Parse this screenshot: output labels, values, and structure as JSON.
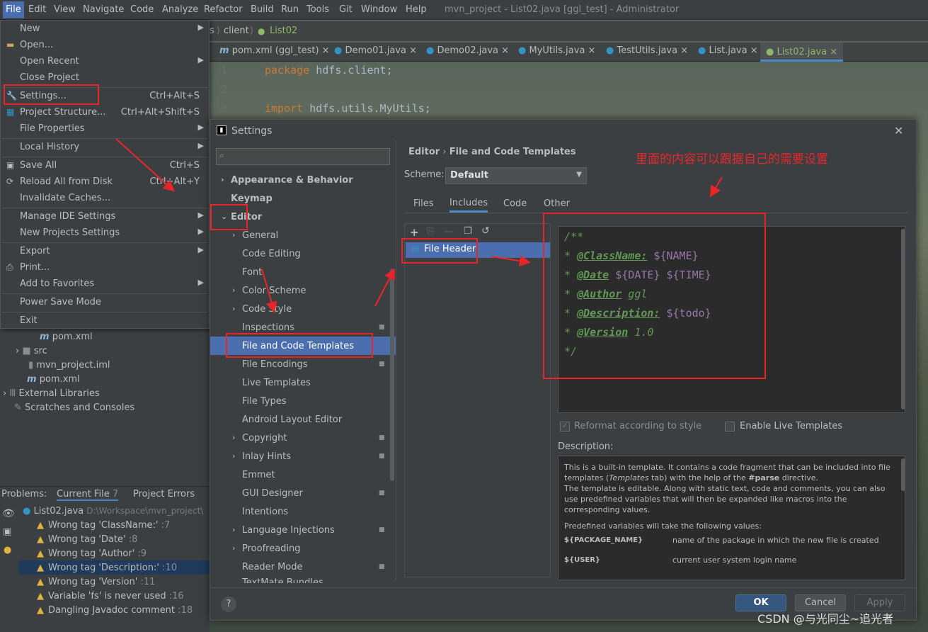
{
  "menubar": {
    "items": [
      "File",
      "Edit",
      "View",
      "Navigate",
      "Code",
      "Analyze",
      "Refactor",
      "Build",
      "Run",
      "Tools",
      "Git",
      "Window",
      "Help"
    ],
    "window_title": "mvn_project - List02.java [ggl_test] - Administrator"
  },
  "breadcrumb": {
    "part1": "s",
    "part2": "client",
    "part3": "List02"
  },
  "editor_tabs": [
    "pom.xml (ggl_test)",
    "Demo01.java",
    "Demo02.java",
    "MyUtils.java",
    "TestUtils.java",
    "List.java",
    "List02.java"
  ],
  "code": {
    "line1_no": "1",
    "line1_kw": "package",
    "line1_rest": " hdfs.client;",
    "line2_no": "2",
    "line3_no": "3",
    "line3_kw": "import",
    "line3_rest": " hdfs.utils.MyUtils;"
  },
  "file_menu": {
    "new": "New",
    "open": "Open...",
    "open_recent": "Open Recent",
    "close_project": "Close Project",
    "settings": "Settings...",
    "settings_sc": "Ctrl+Alt+S",
    "project_structure": "Project Structure...",
    "project_structure_sc": "Ctrl+Alt+Shift+S",
    "file_properties": "File Properties",
    "local_history": "Local History",
    "save_all": "Save All",
    "save_all_sc": "Ctrl+S",
    "reload": "Reload All from Disk",
    "reload_sc": "Ctrl+Alt+Y",
    "invalidate": "Invalidate Caches...",
    "manage_ide": "Manage IDE Settings",
    "new_projects": "New Projects Settings",
    "export": "Export",
    "print": "Print...",
    "favorites": "Add to Favorites",
    "power_save": "Power Save Mode",
    "exit": "Exit"
  },
  "project_tree": {
    "pom1": "pom.xml",
    "src": "src",
    "iml": "mvn_project.iml",
    "pom2": "pom.xml",
    "ext_libs": "External Libraries",
    "scratches": "Scratches and Consoles"
  },
  "problems": {
    "tab_label": "Problems:",
    "current_file": "Current File",
    "current_file_count": "7",
    "project_errors": "Project Errors",
    "file": "List02.java",
    "path": "D:\\Workspace\\mvn_project\\",
    "items": [
      {
        "text": "Wrong tag 'ClassName:'",
        "line": ":7"
      },
      {
        "text": "Wrong tag 'Date'",
        "line": ":8"
      },
      {
        "text": "Wrong tag 'Author'",
        "line": ":9"
      },
      {
        "text": "Wrong tag 'Description:'",
        "line": ":10"
      },
      {
        "text": "Wrong tag 'Version'",
        "line": ":11"
      },
      {
        "text": "Variable 'fs' is never used",
        "line": ":16"
      },
      {
        "text": "Dangling Javadoc comment",
        "line": ":18"
      }
    ]
  },
  "settings": {
    "title": "Settings",
    "nav": {
      "appearance": "Appearance & Behavior",
      "keymap": "Keymap",
      "editor": "Editor",
      "general": "General",
      "code_editing": "Code Editing",
      "font": "Font",
      "color_scheme": "Color Scheme",
      "code_style": "Code Style",
      "inspections": "Inspections",
      "file_code_templates": "File and Code Templates",
      "file_encodings": "File Encodings",
      "live_templates": "Live Templates",
      "file_types": "File Types",
      "android_layout": "Android Layout Editor",
      "copyright": "Copyright",
      "inlay_hints": "Inlay Hints",
      "emmet": "Emmet",
      "gui_designer": "GUI Designer",
      "intentions": "Intentions",
      "language_injections": "Language Injections",
      "proofreading": "Proofreading",
      "reader_mode": "Reader Mode",
      "textmate": "TextMate Bundles"
    },
    "crumb_editor": "Editor",
    "crumb_sep": "›",
    "crumb_page": "File and Code Templates",
    "scheme_label": "Scheme:",
    "scheme_value": "Default",
    "tabs": [
      "Files",
      "Includes",
      "Code",
      "Other"
    ],
    "template_item": "File Header",
    "template_lines": {
      "l1": "/**",
      "l2_star": "* ",
      "l2_tag": "@ClassName:",
      "l2_var": " ${NAME}",
      "l3_star": "* ",
      "l3_tag": "@Date",
      "l3_var": " ${DATE} ${TIME}",
      "l4_star": "* ",
      "l4_tag": "@Author",
      "l4_val": " ggl",
      "l5_star": "* ",
      "l5_tag": "@Description:",
      "l5_var": " ${todo}",
      "l6_star": "* ",
      "l6_tag": "@Version",
      "l6_val": " 1.0",
      "l7": "*/"
    },
    "reformat_label": "Reformat according to style",
    "live_templates_label": "Enable Live Templates",
    "description_label": "Description:",
    "desc_p1a": "This is a built-in template. It contains a code fragment that can be included into file templates (",
    "desc_p1_em": "Templates",
    "desc_p1b": " tab) with the help of the ",
    "desc_p1_bold": "#parse",
    "desc_p1c": " directive.",
    "desc_p2": "The template is editable. Along with static text, code and comments, you can also use predefined variables that will then be expanded like macros into the corresponding values.",
    "desc_p3": "Predefined variables will take the following values:",
    "var1_name": "${PACKAGE_NAME}",
    "var1_desc": "name of the package in which the new file is created",
    "var2_name": "${USER}",
    "var2_desc": "current user system login name",
    "ok": "OK",
    "cancel": "Cancel",
    "apply": "Apply",
    "help": "?"
  },
  "annotation_text": "里面的内容可以跟据自己的需要设置",
  "watermark": "CSDN @与光同尘~追光者",
  "colors": {
    "accent": "#4b6eaf",
    "annotation": "#e8262a",
    "javadoc": "#629755",
    "variable": "#9876aa",
    "keyword": "#cc7832"
  }
}
